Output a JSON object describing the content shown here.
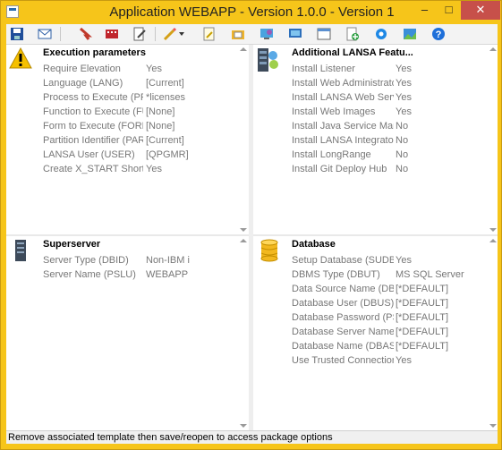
{
  "window": {
    "title": "Application WEBAPP - Version 1.0.0 - Version 1"
  },
  "toolbar": {
    "icons": [
      "save-icon",
      "email-icon",
      "bookmark-icon",
      "film-icon",
      "document-edit-icon",
      "pencil-icon",
      "page-icon",
      "folder-icon",
      "globe-icon",
      "monitor-icon",
      "window-icon",
      "add-icon",
      "gear-icon",
      "image-icon",
      "help-icon"
    ]
  },
  "execution": {
    "title": "Execution parameters",
    "rows": [
      {
        "label": "Require Elevation",
        "value": "Yes"
      },
      {
        "label": "Language (LANG)",
        "value": "[Current]"
      },
      {
        "label": "Process to Execute (PROC)",
        "value": "*licenses"
      },
      {
        "label": "Function to Execute (FUNC)",
        "value": "[None]"
      },
      {
        "label": "Form to Execute (FORM)",
        "value": "[None]"
      },
      {
        "label": "Partition Identifier (PART)",
        "value": "[Current]"
      },
      {
        "label": "LANSA User (USER)",
        "value": "[QPGMR]"
      },
      {
        "label": "Create X_START Shortcuts",
        "value": "Yes"
      }
    ]
  },
  "features": {
    "title": "Additional LANSA Featu...",
    "rows": [
      {
        "label": "Install Listener",
        "value": "Yes"
      },
      {
        "label": "Install Web Administrator",
        "value": "Yes"
      },
      {
        "label": "Install LANSA Web Server E...",
        "value": "Yes"
      },
      {
        "label": "Install Web Images",
        "value": "Yes"
      },
      {
        "label": "Install Java Service Manager",
        "value": "No"
      },
      {
        "label": "Install LANSA Integrator Stu...",
        "value": "No"
      },
      {
        "label": "Install LongRange",
        "value": "No"
      },
      {
        "label": "Install Git Deploy Hub",
        "value": "No"
      }
    ]
  },
  "superserver": {
    "title": "Superserver",
    "rows": [
      {
        "label": "Server Type (DBID)",
        "value": "Non-IBM i"
      },
      {
        "label": "Server Name (PSLU)",
        "value": "WEBAPP"
      }
    ]
  },
  "database": {
    "title": "Database",
    "rows": [
      {
        "label": "Setup Database (SUDB)",
        "value": "Yes"
      },
      {
        "label": "DBMS Type (DBUT)",
        "value": "MS SQL Server"
      },
      {
        "label": "Data Source Name (DBII)",
        "value": "[*DEFAULT]"
      },
      {
        "label": "Database User (DBUS)",
        "value": "[*DEFAULT]"
      },
      {
        "label": "Database Password (PSWD)",
        "value": "[*DEFAULT]"
      },
      {
        "label": "Database Server Name (DB...",
        "value": "[*DEFAULT]"
      },
      {
        "label": "Database Name (DBAS)",
        "value": "[*DEFAULT]"
      },
      {
        "label": "Use Trusted Connection (DB...",
        "value": "Yes"
      }
    ]
  },
  "status": {
    "text": "Remove associated template then save/reopen to access package options"
  }
}
